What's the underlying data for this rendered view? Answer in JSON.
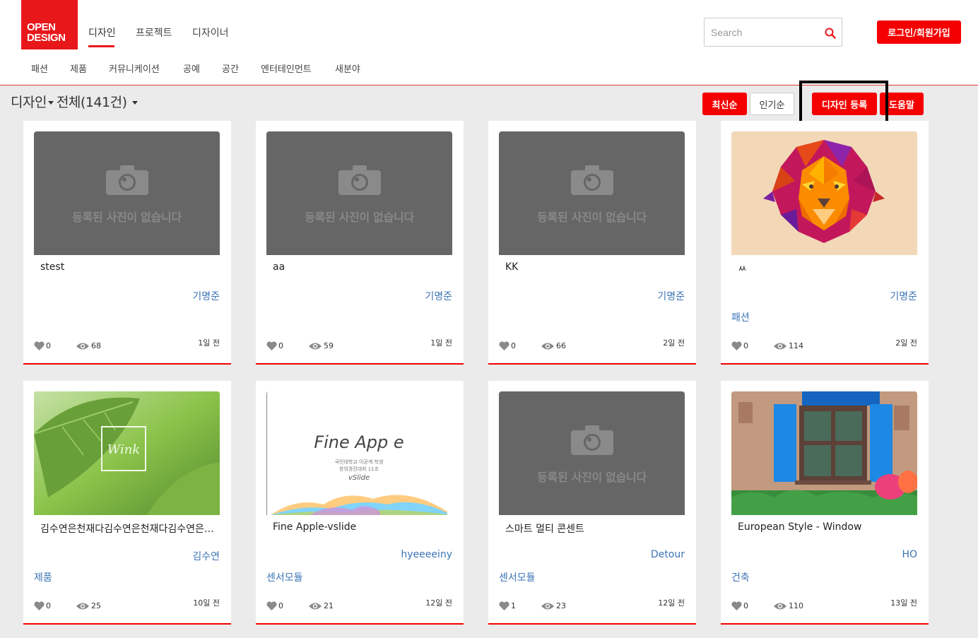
{
  "logo": {
    "line1": "OPEN",
    "line2": "DESIGN"
  },
  "main_nav": [
    {
      "label": "디자인",
      "active": true
    },
    {
      "label": "프로젝트",
      "active": false
    },
    {
      "label": "디자이너",
      "active": false
    }
  ],
  "sub_nav": [
    "패션",
    "제품",
    "커뮤니케이션",
    "공예",
    "공간",
    "엔터테인먼트",
    "새분야"
  ],
  "search": {
    "placeholder": "Search",
    "value": ""
  },
  "login_label": "로그인/회원가입",
  "page_title": {
    "section": "디자인",
    "filter": "전체(141건)"
  },
  "sort_buttons": {
    "latest": "최신순",
    "popular": "인기순"
  },
  "register_label": "디자인 등록",
  "help_label": "도움말",
  "colors": {
    "brand_red": "#f50000",
    "link_blue": "#3b74b5",
    "highlight": "#000000"
  },
  "no_image_text": "등록된 사진이 없습니다",
  "cards": [
    {
      "title": "stest",
      "author": "기명준",
      "category": "",
      "likes": "0",
      "views": "68",
      "date": "1일 전",
      "image": "none"
    },
    {
      "title": "aa",
      "author": "기명준",
      "category": "",
      "likes": "0",
      "views": "59",
      "date": "1일 전",
      "image": "none"
    },
    {
      "title": "KK",
      "author": "기명준",
      "category": "",
      "likes": "0",
      "views": "66",
      "date": "2일 전",
      "image": "none"
    },
    {
      "title": "ㅆ",
      "author": "기명준",
      "category": "패션",
      "likes": "0",
      "views": "114",
      "date": "2일 전",
      "image": "geometric-lion"
    },
    {
      "title": "김수연은천재다김수연은천재다김수연은천재다",
      "author": "김수연",
      "category": "제품",
      "likes": "0",
      "views": "25",
      "date": "10일 전",
      "image": "green-leaves-wink"
    },
    {
      "title": "Fine Apple-vslide",
      "author": "hyeeeeiny",
      "category": "센서모듈",
      "likes": "0",
      "views": "21",
      "date": "12일 전",
      "image": "fine-apple-slide"
    },
    {
      "title": "스마트 멀티 콘센트",
      "author": "Detour",
      "category": "센서모듈",
      "likes": "1",
      "views": "23",
      "date": "12일 전",
      "image": "none"
    },
    {
      "title": "European Style - Window",
      "author": "HO",
      "category": "건축",
      "likes": "0",
      "views": "110",
      "date": "13일 전",
      "image": "painted-window"
    }
  ],
  "fine_apple_text": {
    "title": "Fine  App e",
    "sub1": "국민대학교 이공계 학생",
    "sub2": "창의경진대회 11조",
    "sub3": "vSlide"
  },
  "wink_text": "Wink"
}
